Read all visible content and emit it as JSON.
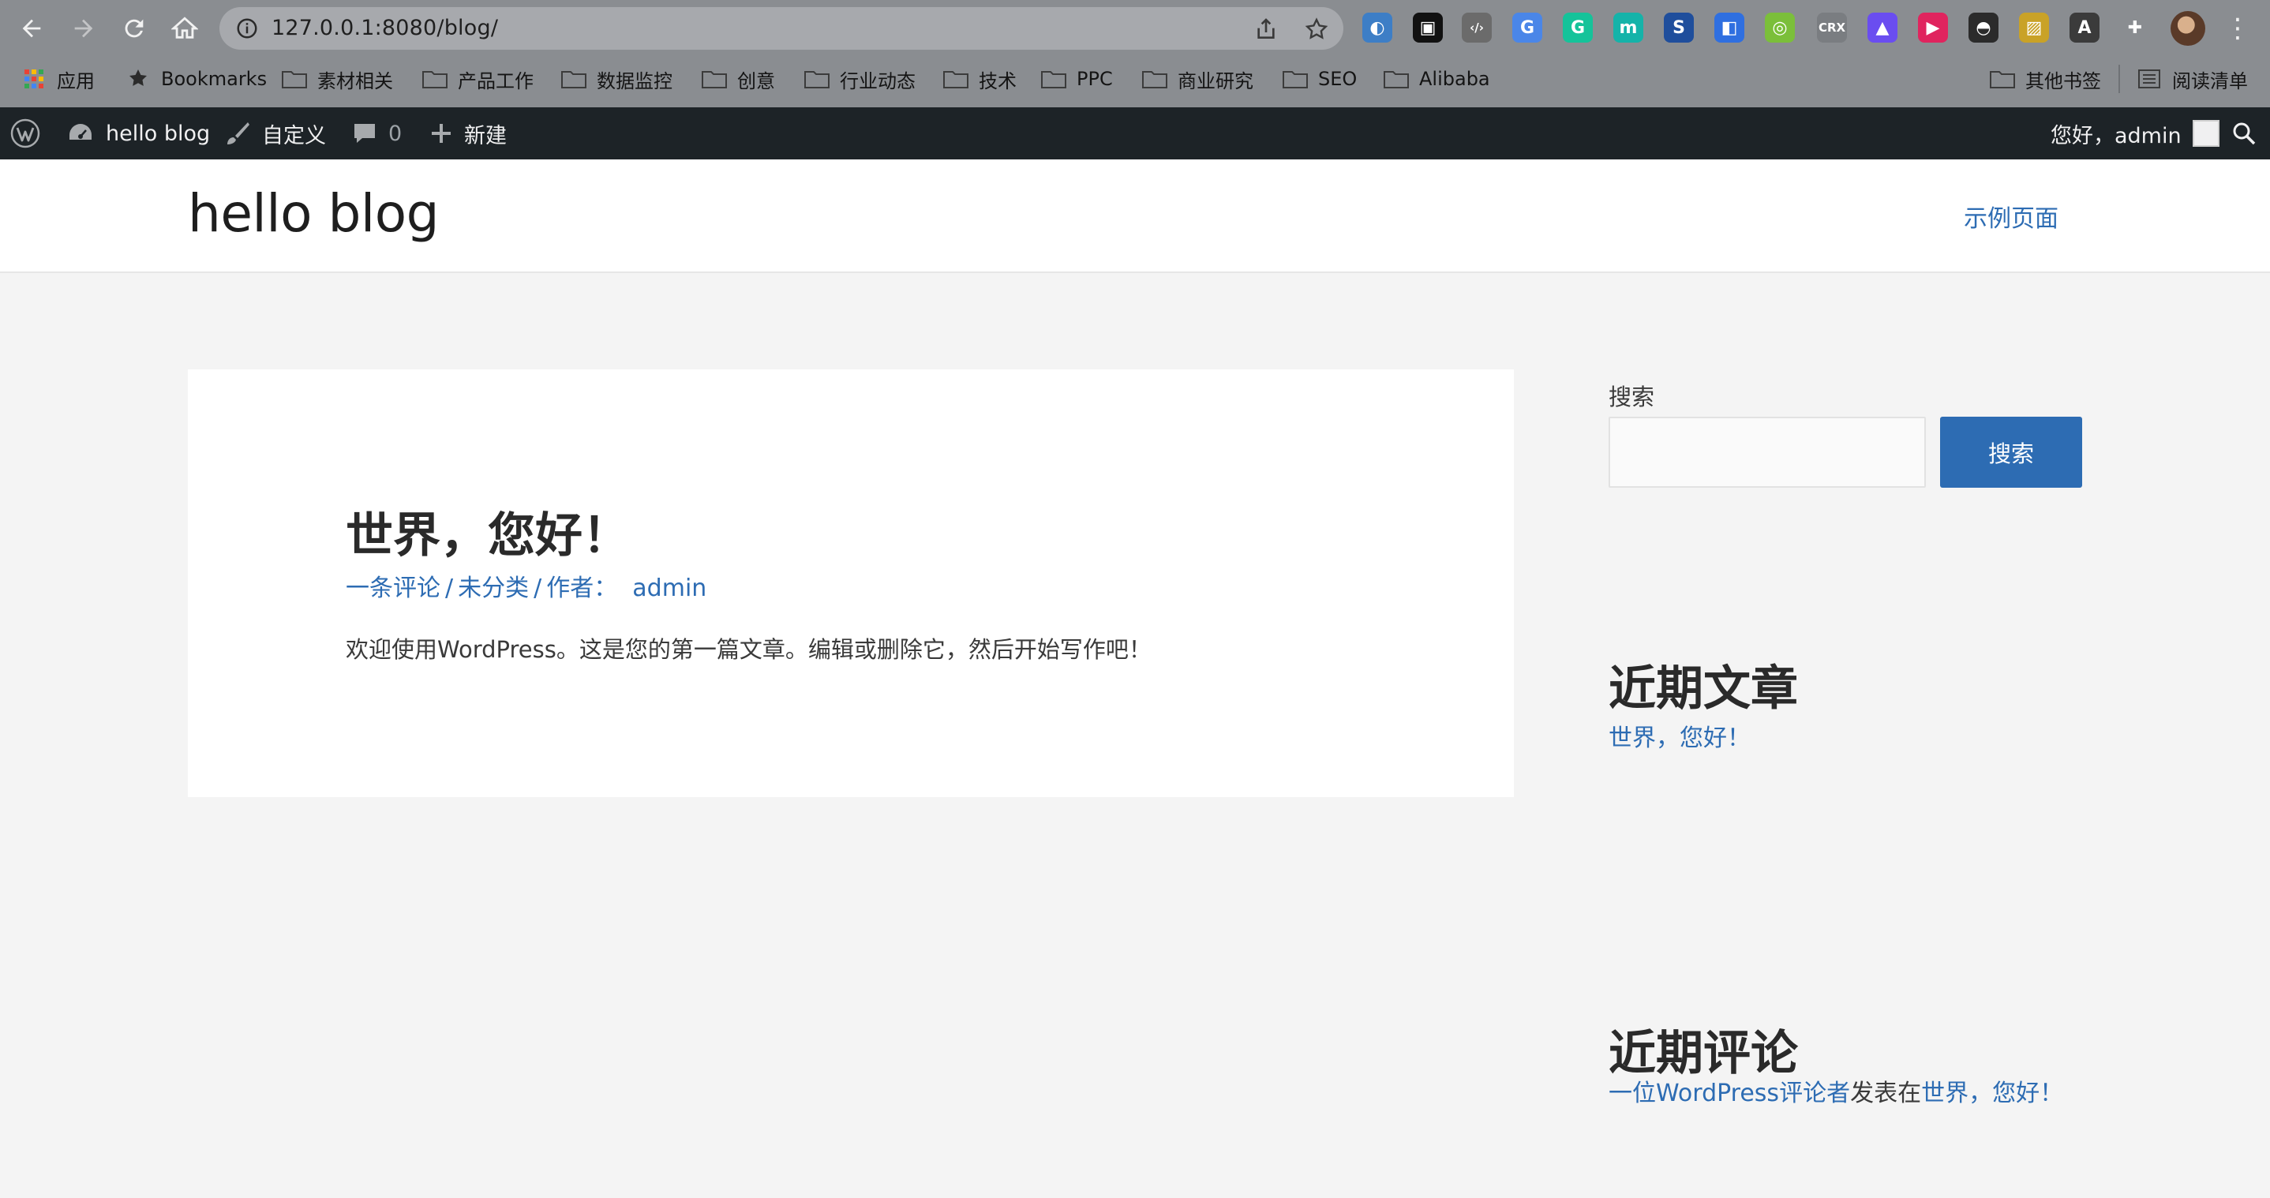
{
  "browser": {
    "url": "127.0.0.1:8080/blog/",
    "bookmarks": [
      {
        "label": "应用",
        "icon": "apps-grid-icon"
      },
      {
        "label": "Bookmarks",
        "icon": "star-icon"
      },
      {
        "label": "素材相关",
        "icon": "folder-icon"
      },
      {
        "label": "产品工作",
        "icon": "folder-icon"
      },
      {
        "label": "数据监控",
        "icon": "folder-icon"
      },
      {
        "label": "创意",
        "icon": "folder-icon"
      },
      {
        "label": "行业动态",
        "icon": "folder-icon"
      },
      {
        "label": "技术",
        "icon": "folder-icon"
      },
      {
        "label": "PPC",
        "icon": "folder-icon"
      },
      {
        "label": "商业研究",
        "icon": "folder-icon"
      },
      {
        "label": "SEO",
        "icon": "folder-icon"
      },
      {
        "label": "Alibaba",
        "icon": "folder-icon"
      }
    ],
    "other_bookmarks": "其他书签",
    "reading_list": "阅读清单",
    "extensions": [
      {
        "name": "edge-extension-icon",
        "color": "#3d7ec6",
        "glyph": "◐"
      },
      {
        "name": "box-extension-icon",
        "color": "#111111",
        "glyph": "▣"
      },
      {
        "name": "code-extension-icon",
        "color": "#6b6b6b",
        "glyph": "‹/›"
      },
      {
        "name": "translate-extension-icon",
        "color": "#4a86e8",
        "glyph": "G"
      },
      {
        "name": "grammarly-extension-icon",
        "color": "#15c39a",
        "glyph": "G"
      },
      {
        "name": "m-extension-icon",
        "color": "#15b3a9",
        "glyph": "m"
      },
      {
        "name": "s-extension-icon",
        "color": "#1f4e9c",
        "glyph": "S"
      },
      {
        "name": "sidebar-extension-icon",
        "color": "#2f6fe0",
        "glyph": "◧"
      },
      {
        "name": "ring-extension-icon",
        "color": "#7bbf3a",
        "glyph": "◎"
      },
      {
        "name": "crx-extension-icon",
        "color": "#7a7d81",
        "glyph": "CRX"
      },
      {
        "name": "peak-extension-icon",
        "color": "#6a4df0",
        "glyph": "▲"
      },
      {
        "name": "play-extension-icon",
        "color": "#e0245e",
        "glyph": "▶"
      },
      {
        "name": "spy-extension-icon",
        "color": "#2b2b2b",
        "glyph": "◓"
      },
      {
        "name": "image-extension-icon",
        "color": "#c9a227",
        "glyph": "▨"
      },
      {
        "name": "font-extension-icon",
        "color": "#3b3b3b",
        "glyph": "A"
      },
      {
        "name": "puzzle-extension-icon",
        "color": "#8a8d91",
        "glyph": "✚"
      }
    ]
  },
  "adminbar": {
    "site_name": "hello blog",
    "customize": "自定义",
    "comments_count": "0",
    "new": "新建",
    "greeting": "您好，admin"
  },
  "site": {
    "title": "hello blog",
    "nav_item": "示例页面"
  },
  "post": {
    "title": "世界，您好！",
    "meta_comments": "一条评论",
    "meta_category": "未分类",
    "meta_author_label": "作者：",
    "meta_author": "admin",
    "excerpt": "欢迎使用WordPress。这是您的第一篇文章。编辑或删除它，然后开始写作吧！"
  },
  "sidebar": {
    "search_label": "搜索",
    "search_value": "",
    "search_button": "搜索",
    "recent_posts_title": "近期文章",
    "recent_post": "世界，您好！",
    "recent_comments_title": "近期评论",
    "comment_author": "一位WordPress评论者",
    "comment_on": "发表在",
    "comment_post": "世界，您好！"
  },
  "colors": {
    "link": "#2d6cb3",
    "adminbar": "#1d2327",
    "chrome": "#8a8d91"
  }
}
